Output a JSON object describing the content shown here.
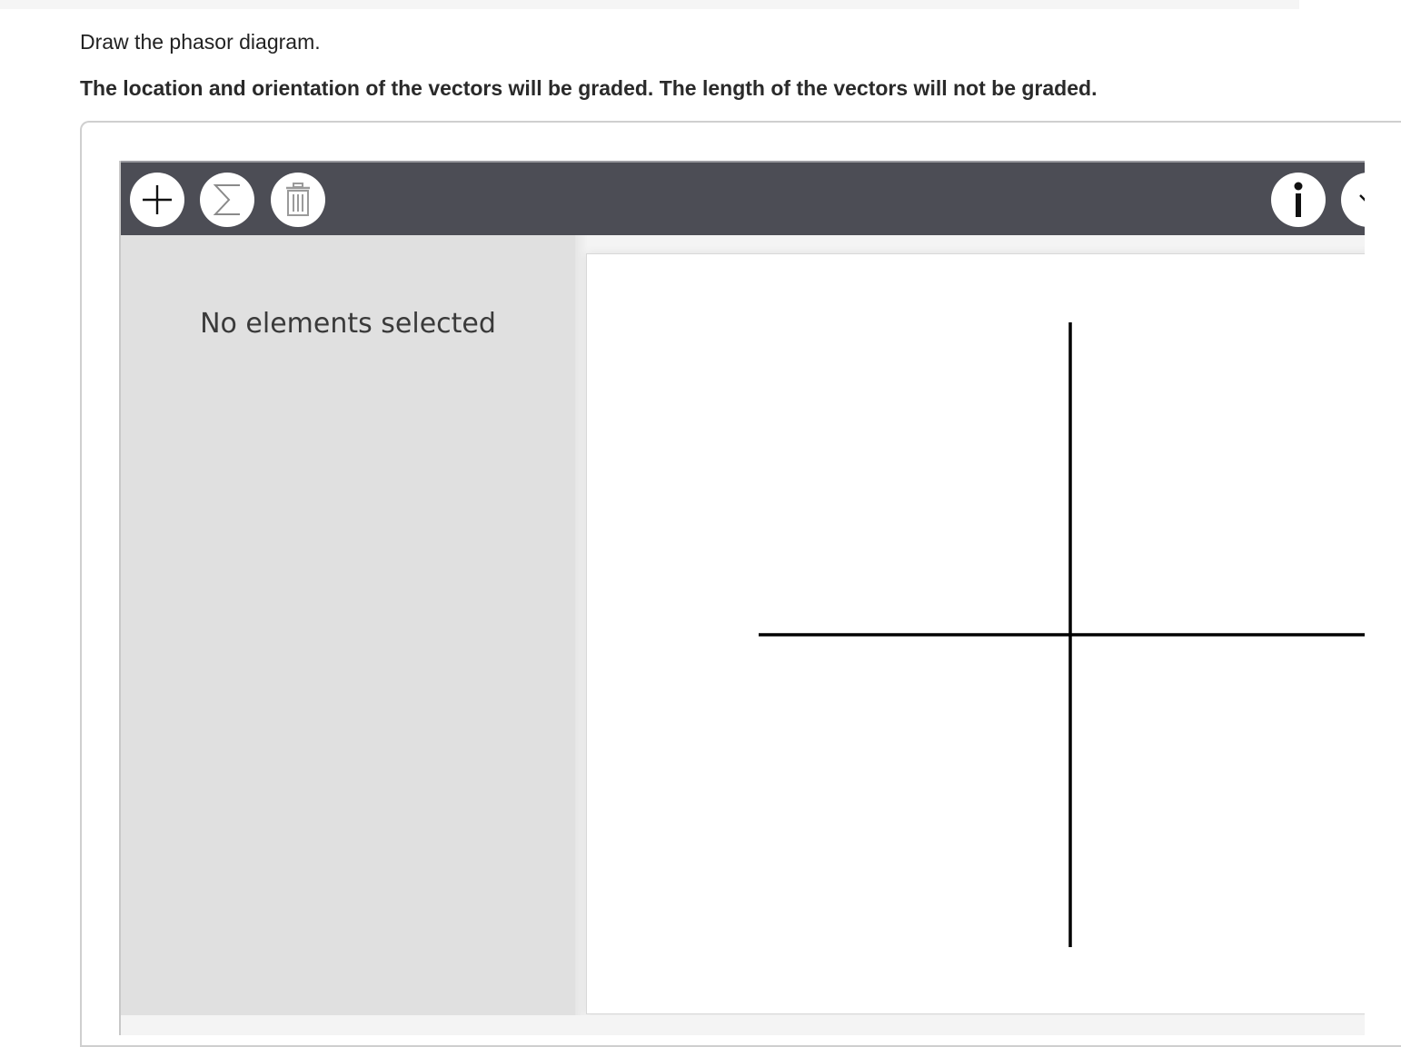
{
  "question": {
    "instruction": "Draw the phasor diagram.",
    "grading_note": "The location and orientation of the vectors will be graded. The length of the vectors will not be graded."
  },
  "toolbar": {
    "buttons": [
      {
        "name": "add",
        "icon": "plus-icon"
      },
      {
        "name": "sum",
        "icon": "sigma-icon"
      },
      {
        "name": "delete",
        "icon": "trash-icon"
      },
      {
        "name": "info",
        "icon": "info-icon"
      },
      {
        "name": "more",
        "icon": "chevron-down-icon"
      }
    ]
  },
  "sidebar": {
    "status_text": "No elements selected"
  },
  "canvas": {
    "axes": "horizontal and vertical reference axes crossing at origin"
  }
}
